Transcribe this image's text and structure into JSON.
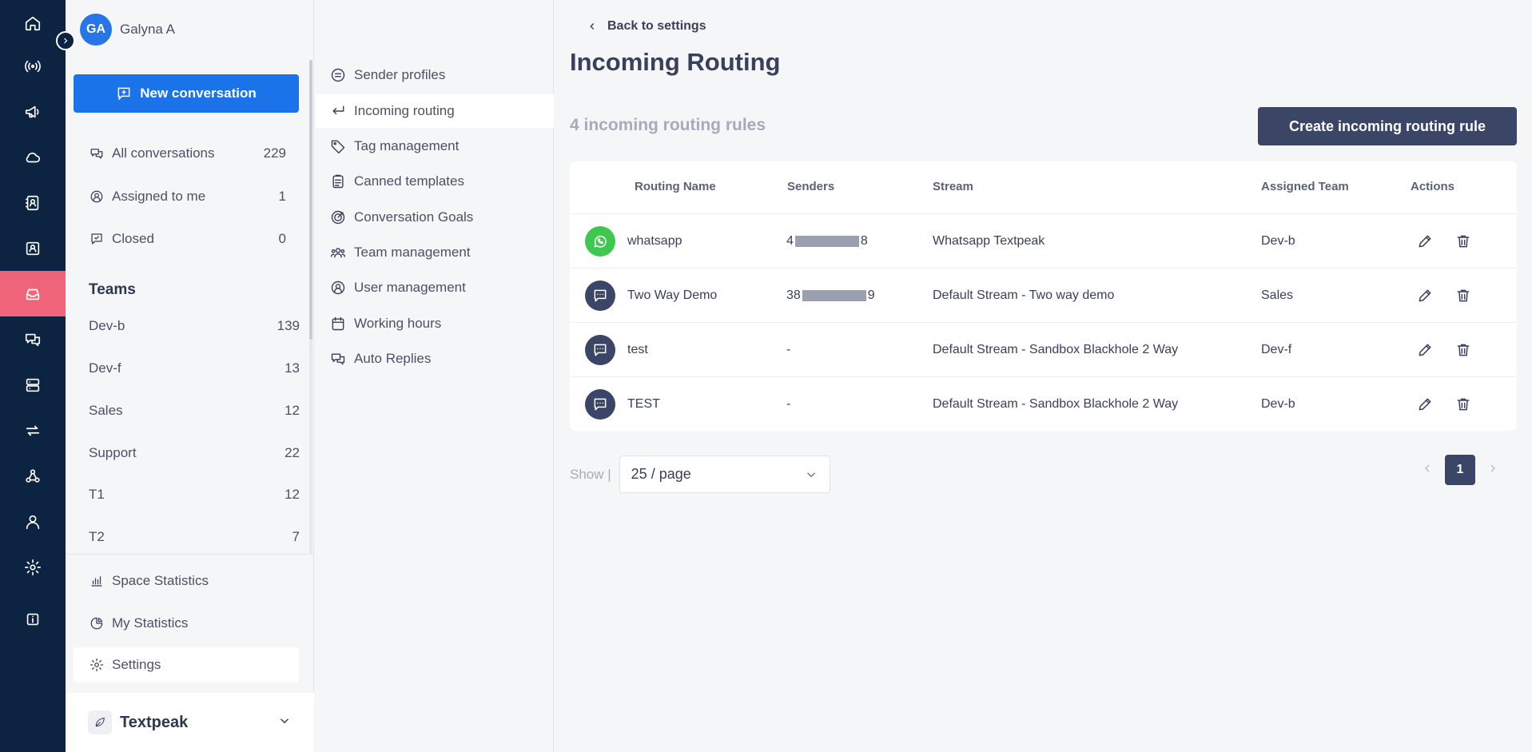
{
  "rail": {
    "items": [
      {
        "icon": "home-icon"
      },
      {
        "icon": "broadcast-icon"
      },
      {
        "icon": "megaphone-icon"
      },
      {
        "icon": "cloud-icon"
      },
      {
        "icon": "contacts-book-icon"
      },
      {
        "icon": "contact-card-icon"
      },
      {
        "icon": "inbox-icon",
        "active": true
      },
      {
        "icon": "chat-bubbles-icon"
      },
      {
        "icon": "server-icon"
      },
      {
        "icon": "swap-arrows-icon"
      },
      {
        "icon": "webhook-icon"
      },
      {
        "icon": "user-icon"
      },
      {
        "icon": "gear-icon"
      },
      {
        "icon": "info-icon"
      }
    ],
    "active_color": "#f0647a",
    "background": "#0d2342"
  },
  "sidebar": {
    "user": {
      "initials": "GA",
      "name": "Galyna A"
    },
    "new_conversation_label": "New conversation",
    "filters": [
      {
        "label": "All conversations",
        "count": "229"
      },
      {
        "label": "Assigned to me",
        "count": "1"
      },
      {
        "label": "Closed",
        "count": "0"
      }
    ],
    "teams_title": "Teams",
    "teams": [
      {
        "label": "Dev-b",
        "count": "139"
      },
      {
        "label": "Dev-f",
        "count": "13"
      },
      {
        "label": "Sales",
        "count": "12"
      },
      {
        "label": "Support",
        "count": "22"
      },
      {
        "label": "T1",
        "count": "12"
      },
      {
        "label": "T2",
        "count": "7"
      }
    ],
    "bottom": [
      {
        "label": "Space Statistics"
      },
      {
        "label": "My Statistics"
      },
      {
        "label": "Settings",
        "active": true
      }
    ],
    "workspace": "Textpeak"
  },
  "settings_menu": {
    "items": [
      {
        "label": "Sender profiles"
      },
      {
        "label": "Incoming routing",
        "active": true
      },
      {
        "label": "Tag management"
      },
      {
        "label": "Canned templates"
      },
      {
        "label": "Conversation Goals"
      },
      {
        "label": "Team management"
      },
      {
        "label": "User management"
      },
      {
        "label": "Working hours"
      },
      {
        "label": "Auto Replies"
      }
    ]
  },
  "main": {
    "back_label": "Back to settings",
    "title": "Incoming Routing",
    "rules_count": "4 incoming routing rules",
    "create_button": "Create incoming routing rule",
    "table": {
      "columns": [
        "Routing Name",
        "Senders",
        "Stream",
        "Assigned Team",
        "Actions"
      ],
      "rows": [
        {
          "channel": "whatsapp",
          "name": "whatsapp",
          "sender_prefix": "4",
          "sender_suffix": "8",
          "redacted": true,
          "stream": "Whatsapp Textpeak",
          "team": "Dev-b"
        },
        {
          "channel": "sms",
          "name": "Two Way Demo",
          "sender_prefix": "38",
          "sender_suffix": "9",
          "redacted": true,
          "stream": "Default Stream - Two way demo",
          "team": "Sales"
        },
        {
          "channel": "sms",
          "name": "test",
          "sender_prefix": "-",
          "sender_suffix": "",
          "redacted": false,
          "stream": "Default Stream - Sandbox Blackhole 2 Way",
          "team": "Dev-f"
        },
        {
          "channel": "sms",
          "name": "TEST",
          "sender_prefix": "-",
          "sender_suffix": "",
          "redacted": false,
          "stream": "Default Stream - Sandbox Blackhole 2 Way",
          "team": "Dev-b"
        }
      ]
    },
    "show_label": "Show |",
    "page_size": "25 / page",
    "current_page": "1"
  },
  "colors": {
    "primary_blue": "#1a73e8",
    "dark_navy": "#3b4566",
    "whatsapp_green": "#3fc84f",
    "sms_navy": "#3b4566"
  }
}
